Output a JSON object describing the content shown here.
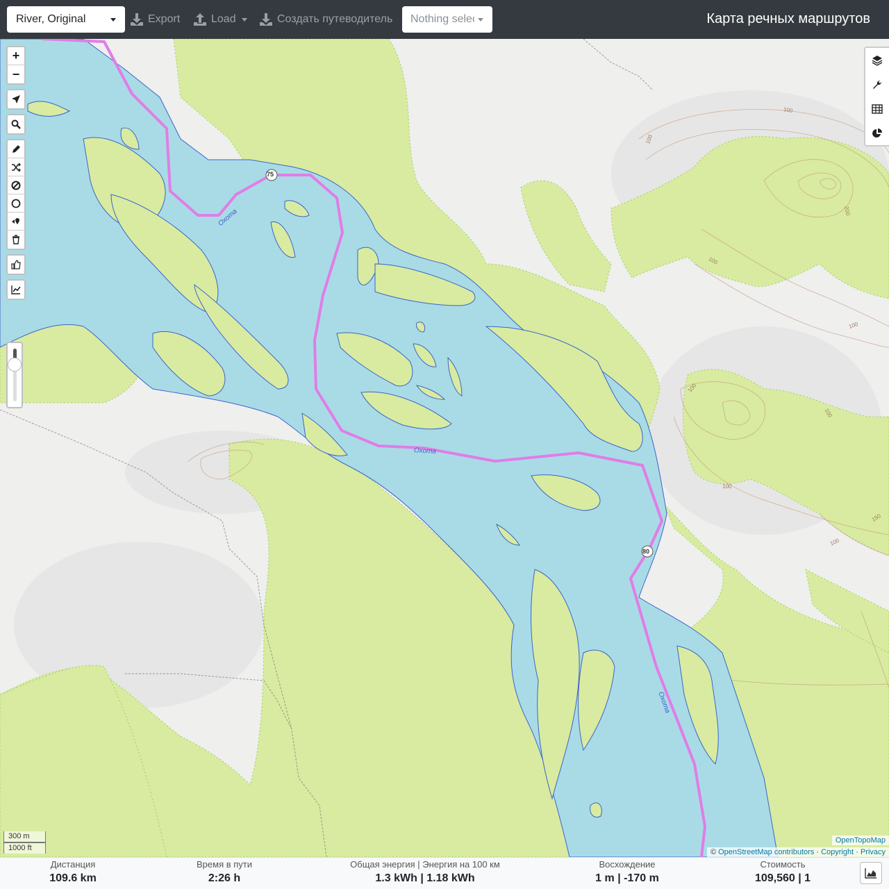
{
  "navbar": {
    "profile": "River, Original",
    "export_label": "Export",
    "load_label": "Load",
    "guide_label": "Создать путеводитель",
    "selection_placeholder": "Nothing selected",
    "title": "Карта речных маршрутов"
  },
  "map": {
    "river_name": "Охота",
    "route_color": "#e07de6",
    "water_color": "#a9dbe6",
    "forest_color": "#d8eba0",
    "waypoints": [
      "75",
      "80"
    ],
    "contour_labels": [
      "100",
      "100",
      "100",
      "100",
      "100",
      "100",
      "200",
      "100",
      "150",
      "100",
      "100"
    ],
    "scale_metric": "300 m",
    "scale_imperial": "1000 ft",
    "attribution_layer": "OpenTopoMap",
    "attribution_prefix": "©",
    "attribution_osm": "OpenStreetMap contributors",
    "attribution_copyright": "Copyright",
    "attribution_privacy": "Privacy"
  },
  "left_controls": {
    "zoom_in": "+",
    "zoom_out": "−",
    "icons": [
      "locate-icon",
      "search-icon",
      "pencil-icon",
      "shuffle-icon",
      "no-entry-icon",
      "circle-icon",
      "route-poi-icon",
      "trash-icon",
      "thumbs-up-icon",
      "elevation-chart-icon"
    ],
    "zoom_level_fraction": 0.3
  },
  "right_controls": [
    "layers-icon",
    "wrench-icon",
    "table-icon",
    "pie-chart-icon"
  ],
  "stats": {
    "distance_label": "Дистанция",
    "distance_value": "109.6 km",
    "time_label": "Время в пути",
    "time_value": "2:26 h",
    "energy_label": "Общая энергия | Энергия на 100 км",
    "energy_value": "1.3 kWh | 1.18 kWh",
    "ascent_label": "Восхождение",
    "ascent_value": "1 m | -170 m",
    "cost_label": "Стоимость",
    "cost_value": "109,560 | 1"
  }
}
